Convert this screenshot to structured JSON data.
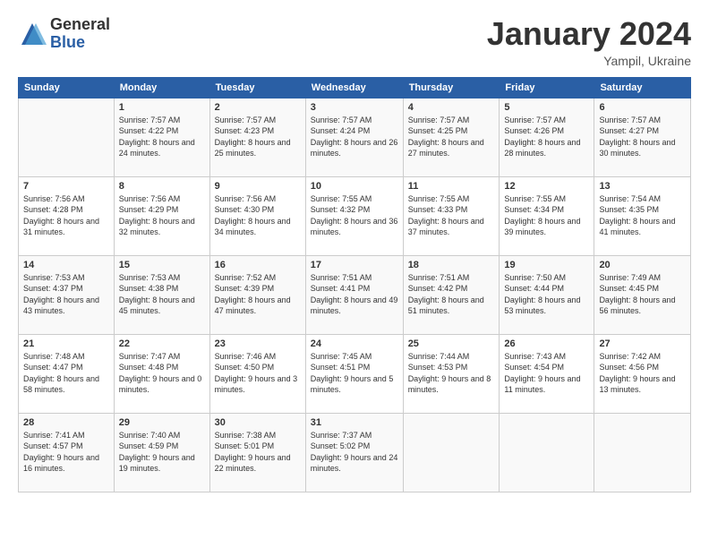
{
  "logo": {
    "general": "General",
    "blue": "Blue"
  },
  "title": "January 2024",
  "subtitle": "Yampil, Ukraine",
  "days_header": [
    "Sunday",
    "Monday",
    "Tuesday",
    "Wednesday",
    "Thursday",
    "Friday",
    "Saturday"
  ],
  "weeks": [
    [
      {
        "day": "",
        "sunrise": "",
        "sunset": "",
        "daylight": ""
      },
      {
        "day": "1",
        "sunrise": "Sunrise: 7:57 AM",
        "sunset": "Sunset: 4:22 PM",
        "daylight": "Daylight: 8 hours and 24 minutes."
      },
      {
        "day": "2",
        "sunrise": "Sunrise: 7:57 AM",
        "sunset": "Sunset: 4:23 PM",
        "daylight": "Daylight: 8 hours and 25 minutes."
      },
      {
        "day": "3",
        "sunrise": "Sunrise: 7:57 AM",
        "sunset": "Sunset: 4:24 PM",
        "daylight": "Daylight: 8 hours and 26 minutes."
      },
      {
        "day": "4",
        "sunrise": "Sunrise: 7:57 AM",
        "sunset": "Sunset: 4:25 PM",
        "daylight": "Daylight: 8 hours and 27 minutes."
      },
      {
        "day": "5",
        "sunrise": "Sunrise: 7:57 AM",
        "sunset": "Sunset: 4:26 PM",
        "daylight": "Daylight: 8 hours and 28 minutes."
      },
      {
        "day": "6",
        "sunrise": "Sunrise: 7:57 AM",
        "sunset": "Sunset: 4:27 PM",
        "daylight": "Daylight: 8 hours and 30 minutes."
      }
    ],
    [
      {
        "day": "7",
        "sunrise": "Sunrise: 7:56 AM",
        "sunset": "Sunset: 4:28 PM",
        "daylight": "Daylight: 8 hours and 31 minutes."
      },
      {
        "day": "8",
        "sunrise": "Sunrise: 7:56 AM",
        "sunset": "Sunset: 4:29 PM",
        "daylight": "Daylight: 8 hours and 32 minutes."
      },
      {
        "day": "9",
        "sunrise": "Sunrise: 7:56 AM",
        "sunset": "Sunset: 4:30 PM",
        "daylight": "Daylight: 8 hours and 34 minutes."
      },
      {
        "day": "10",
        "sunrise": "Sunrise: 7:55 AM",
        "sunset": "Sunset: 4:32 PM",
        "daylight": "Daylight: 8 hours and 36 minutes."
      },
      {
        "day": "11",
        "sunrise": "Sunrise: 7:55 AM",
        "sunset": "Sunset: 4:33 PM",
        "daylight": "Daylight: 8 hours and 37 minutes."
      },
      {
        "day": "12",
        "sunrise": "Sunrise: 7:55 AM",
        "sunset": "Sunset: 4:34 PM",
        "daylight": "Daylight: 8 hours and 39 minutes."
      },
      {
        "day": "13",
        "sunrise": "Sunrise: 7:54 AM",
        "sunset": "Sunset: 4:35 PM",
        "daylight": "Daylight: 8 hours and 41 minutes."
      }
    ],
    [
      {
        "day": "14",
        "sunrise": "Sunrise: 7:53 AM",
        "sunset": "Sunset: 4:37 PM",
        "daylight": "Daylight: 8 hours and 43 minutes."
      },
      {
        "day": "15",
        "sunrise": "Sunrise: 7:53 AM",
        "sunset": "Sunset: 4:38 PM",
        "daylight": "Daylight: 8 hours and 45 minutes."
      },
      {
        "day": "16",
        "sunrise": "Sunrise: 7:52 AM",
        "sunset": "Sunset: 4:39 PM",
        "daylight": "Daylight: 8 hours and 47 minutes."
      },
      {
        "day": "17",
        "sunrise": "Sunrise: 7:51 AM",
        "sunset": "Sunset: 4:41 PM",
        "daylight": "Daylight: 8 hours and 49 minutes."
      },
      {
        "day": "18",
        "sunrise": "Sunrise: 7:51 AM",
        "sunset": "Sunset: 4:42 PM",
        "daylight": "Daylight: 8 hours and 51 minutes."
      },
      {
        "day": "19",
        "sunrise": "Sunrise: 7:50 AM",
        "sunset": "Sunset: 4:44 PM",
        "daylight": "Daylight: 8 hours and 53 minutes."
      },
      {
        "day": "20",
        "sunrise": "Sunrise: 7:49 AM",
        "sunset": "Sunset: 4:45 PM",
        "daylight": "Daylight: 8 hours and 56 minutes."
      }
    ],
    [
      {
        "day": "21",
        "sunrise": "Sunrise: 7:48 AM",
        "sunset": "Sunset: 4:47 PM",
        "daylight": "Daylight: 8 hours and 58 minutes."
      },
      {
        "day": "22",
        "sunrise": "Sunrise: 7:47 AM",
        "sunset": "Sunset: 4:48 PM",
        "daylight": "Daylight: 9 hours and 0 minutes."
      },
      {
        "day": "23",
        "sunrise": "Sunrise: 7:46 AM",
        "sunset": "Sunset: 4:50 PM",
        "daylight": "Daylight: 9 hours and 3 minutes."
      },
      {
        "day": "24",
        "sunrise": "Sunrise: 7:45 AM",
        "sunset": "Sunset: 4:51 PM",
        "daylight": "Daylight: 9 hours and 5 minutes."
      },
      {
        "day": "25",
        "sunrise": "Sunrise: 7:44 AM",
        "sunset": "Sunset: 4:53 PM",
        "daylight": "Daylight: 9 hours and 8 minutes."
      },
      {
        "day": "26",
        "sunrise": "Sunrise: 7:43 AM",
        "sunset": "Sunset: 4:54 PM",
        "daylight": "Daylight: 9 hours and 11 minutes."
      },
      {
        "day": "27",
        "sunrise": "Sunrise: 7:42 AM",
        "sunset": "Sunset: 4:56 PM",
        "daylight": "Daylight: 9 hours and 13 minutes."
      }
    ],
    [
      {
        "day": "28",
        "sunrise": "Sunrise: 7:41 AM",
        "sunset": "Sunset: 4:57 PM",
        "daylight": "Daylight: 9 hours and 16 minutes."
      },
      {
        "day": "29",
        "sunrise": "Sunrise: 7:40 AM",
        "sunset": "Sunset: 4:59 PM",
        "daylight": "Daylight: 9 hours and 19 minutes."
      },
      {
        "day": "30",
        "sunrise": "Sunrise: 7:38 AM",
        "sunset": "Sunset: 5:01 PM",
        "daylight": "Daylight: 9 hours and 22 minutes."
      },
      {
        "day": "31",
        "sunrise": "Sunrise: 7:37 AM",
        "sunset": "Sunset: 5:02 PM",
        "daylight": "Daylight: 9 hours and 24 minutes."
      },
      {
        "day": "",
        "sunrise": "",
        "sunset": "",
        "daylight": ""
      },
      {
        "day": "",
        "sunrise": "",
        "sunset": "",
        "daylight": ""
      },
      {
        "day": "",
        "sunrise": "",
        "sunset": "",
        "daylight": ""
      }
    ]
  ]
}
